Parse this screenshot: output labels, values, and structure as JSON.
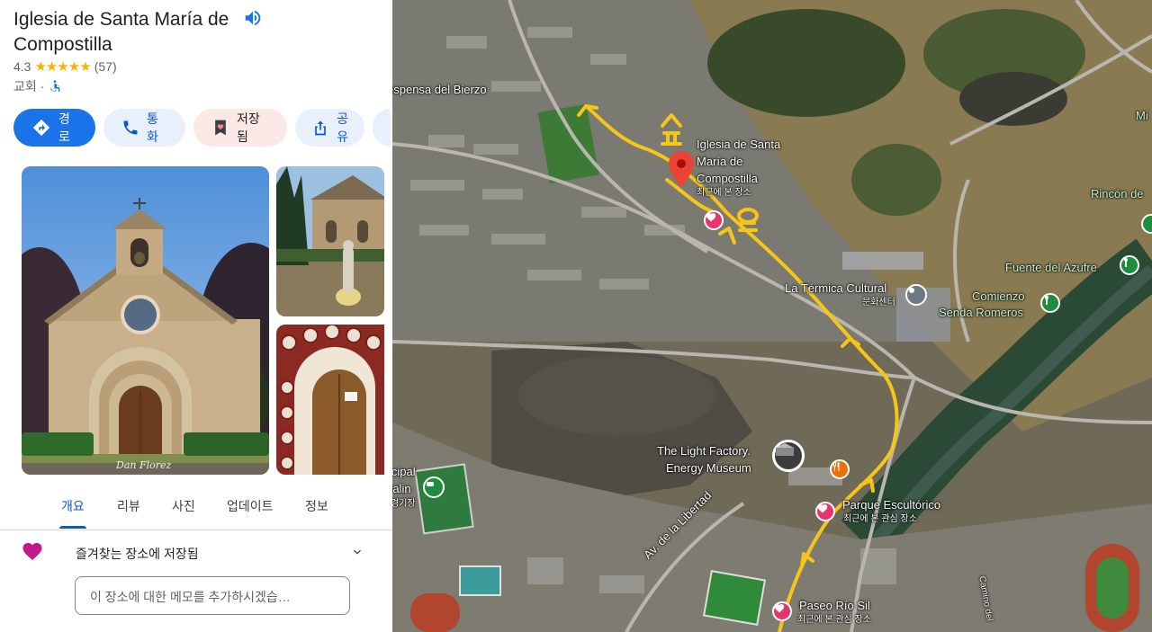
{
  "place": {
    "title": "Iglesia de Santa María de Compostilla",
    "rating": "4.3",
    "stars": "★★★★★",
    "review_count": "(57)",
    "category": "교회 ·"
  },
  "actions": {
    "directions": "경로",
    "call": "통화",
    "saved": "저장됨",
    "share": "공유"
  },
  "photo": {
    "watermark": "Dan Florez"
  },
  "tabs": [
    "개요",
    "리뷰",
    "사진",
    "업데이트",
    "정보"
  ],
  "saved_list": {
    "text": "즐겨찾는 장소에 저장됨"
  },
  "note": {
    "placeholder": "이 장소에 대한 메모를 추가하시겠습…"
  },
  "map": {
    "labels": {
      "despensa": "espensa del Bierzo",
      "church_line1": "Iglesia de Santa",
      "church_line2": "María de",
      "church_line3": "Compostilla",
      "church_sub": "최근에 본 장소",
      "termica": "La Térmica Cultural",
      "termica_sub": "문화센터",
      "comienzo_line1": "Comienzo",
      "comienzo_line2": "Senda Romeros",
      "fuente": "Fuente del Azufre",
      "rincon": "Rincón de",
      "mi": "Mi",
      "light_line1": "The Light Factory.",
      "light_line2": "Energy Museum",
      "parque": "Parque Escultórico",
      "parque_sub": "최근에 본 관심 장소",
      "paseo": "Paseo Río Sil",
      "paseo_sub": "최근에 본 관심 장소",
      "libertad": "Av. de la Libertad",
      "cipal": "icipal",
      "ralin": "ralin",
      "ralin_sub": "경기장",
      "camino": "Camino del"
    },
    "colors": {
      "route": "#f5c518",
      "pin": "#ea4335",
      "saved_heart": "#e8336d",
      "poi_green": "#1e8e3e",
      "brand_blue": "#1a73e8"
    }
  }
}
